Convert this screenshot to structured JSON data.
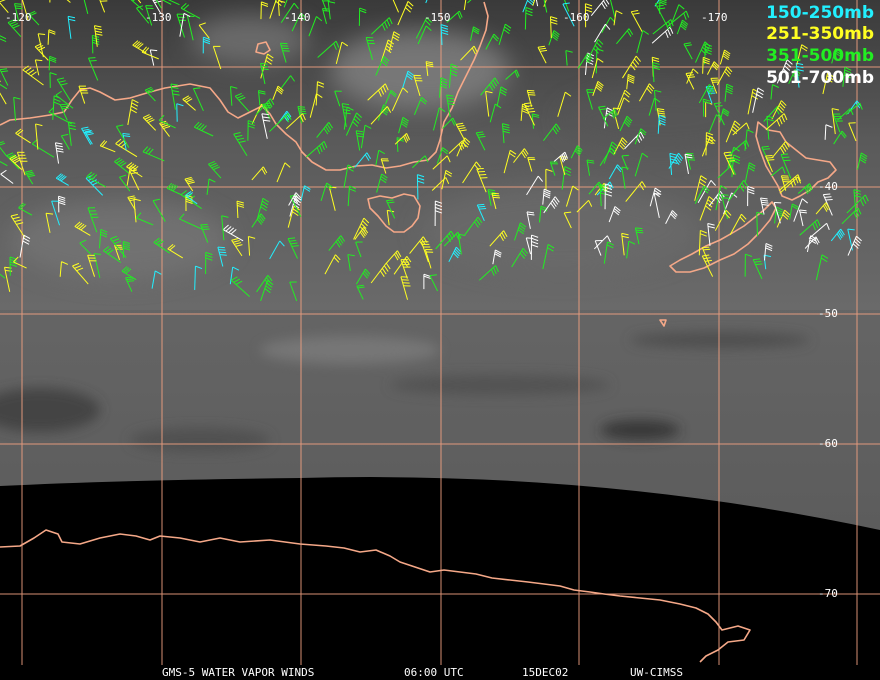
{
  "caption": {
    "product": "GMS-5 WATER VAPOR WINDS",
    "time": "06:00 UTC",
    "date": "15DEC02",
    "source": "UW-CIMSS"
  },
  "legend": [
    {
      "label": "150-250mb",
      "color": "#22f0ff"
    },
    {
      "label": "251-350mb",
      "color": "#ffff22"
    },
    {
      "label": "351-500mb",
      "color": "#22ee22"
    },
    {
      "label": "501-700mb",
      "color": "#ffffff"
    }
  ],
  "graticule": {
    "longitude_labels": [
      "-120",
      "-130",
      "-140",
      "-150",
      "-160",
      "-170"
    ],
    "latitude_labels": [
      "-40",
      "-50",
      "-60",
      "-70"
    ],
    "line_color": "#f0a080",
    "coast_color": "#f5a888"
  }
}
